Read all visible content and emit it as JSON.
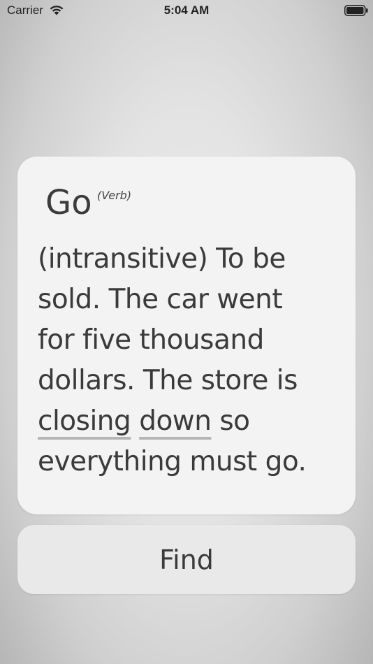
{
  "status_bar": {
    "carrier": "Carrier",
    "time": "5:04 AM",
    "wifi_icon": "wifi-icon",
    "battery_icon": "battery-icon"
  },
  "card": {
    "word": "Go",
    "part_of_speech": "(Verb)",
    "definition_lines": [
      {
        "segments": [
          "(intransitive) To be"
        ]
      },
      {
        "segments": [
          "sold. The car went"
        ]
      },
      {
        "segments": [
          "for five thousand"
        ]
      },
      {
        "segments": [
          "dollars. The store is"
        ]
      },
      {
        "segments": [
          "closing",
          " ",
          "down",
          " so"
        ]
      },
      {
        "segments": [
          "everything must go."
        ]
      }
    ]
  },
  "find_button": {
    "label": "Find"
  },
  "colors": {
    "card_background": "#f3f3f3",
    "button_background": "#e9e9e9",
    "text": "#3a3a3a",
    "link_underline": "#b5b5b5"
  }
}
